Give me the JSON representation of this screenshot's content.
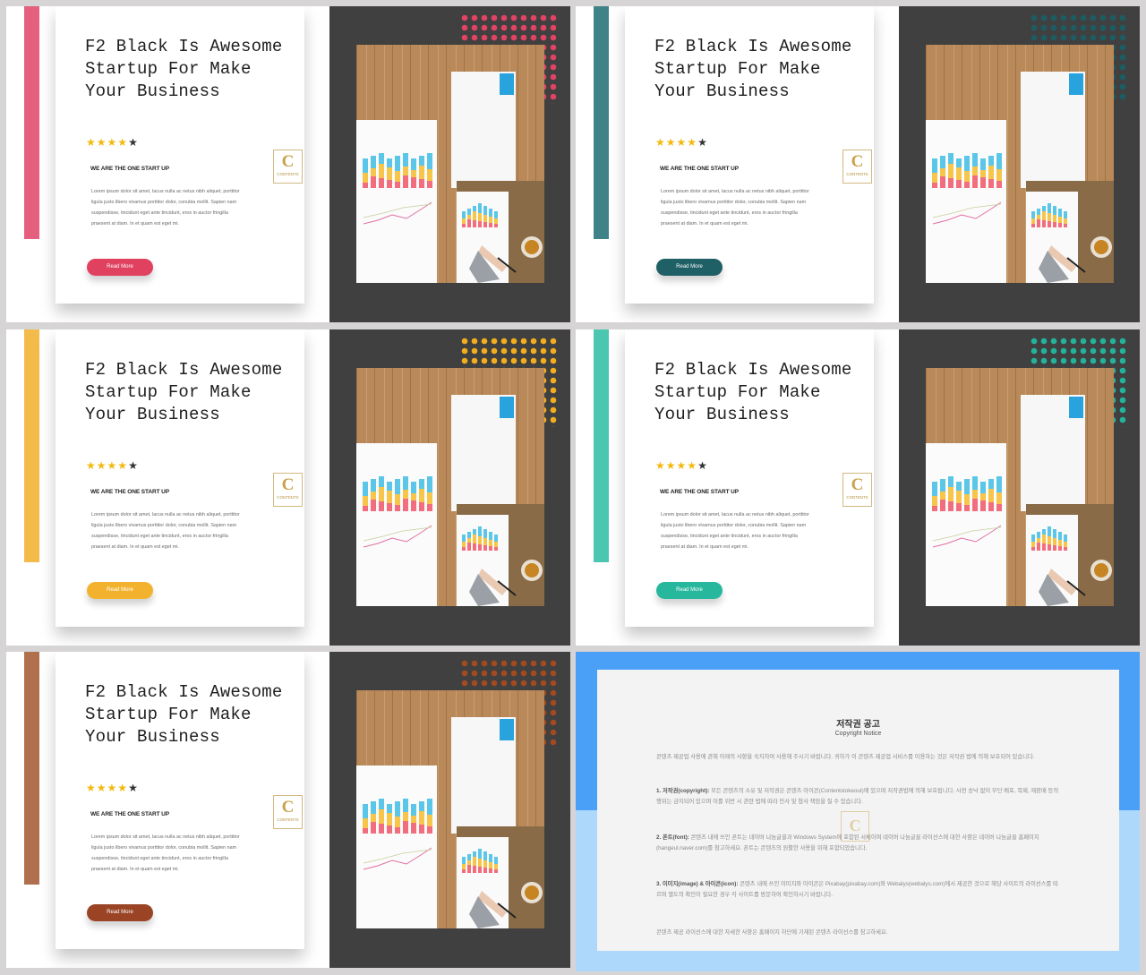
{
  "slides": [
    {
      "title": "F2 Black Is Awesome Startup For Make Your Business",
      "rating": 4,
      "rating_max": 5,
      "subtitle": "WE ARE THE ONE START UP",
      "body": "Lorem ipsum dolor sit amet, lacus nulla ac netus nibh aliquet, porttitor ligula justo libero vivamus porttitor dolor, conubia mollit. Sapien nam suspendisse, tincidunt eget ante tincidunt, eros in auctor fringilla praesent at diam. In et quam est eget mi.",
      "button": "Read More",
      "logo_letter": "C",
      "logo_text": "CONTENTS",
      "accent": "#e55f7e",
      "button_color": "#e0415f",
      "dots_color": "#e24363"
    },
    {
      "title": "F2 Black Is Awesome Startup For Make Your Business",
      "rating": 4,
      "rating_max": 5,
      "subtitle": "WE ARE THE ONE START UP",
      "body": "Lorem ipsum dolor sit amet, lacus nulla ac netus nibh aliquet, porttitor ligula justo libero vivamus porttitor dolor, conubia mollit. Sapien nam suspendisse, tincidunt eget ante tincidunt, eros in auctor fringilla praesent at diam. In et quam est eget mi.",
      "button": "Read More",
      "logo_letter": "C",
      "logo_text": "CONTENTS",
      "accent": "#3f8388",
      "button_color": "#1f5f66",
      "dots_color": "#1c5c63"
    },
    {
      "title": "F2 Black Is Awesome Startup For Make Your Business",
      "rating": 4,
      "rating_max": 5,
      "subtitle": "WE ARE THE ONE START UP",
      "body": "Lorem ipsum dolor sit amet, lacus nulla ac netus nibh aliquet, porttitor ligula justo libero vivamus porttitor dolor, conubia mollit. Sapien nam suspendisse, tincidunt eget ante tincidunt, eros in auctor fringilla praesent at diam. In et quam est eget mi.",
      "button": "Read More",
      "logo_letter": "C",
      "logo_text": "CONTENTS",
      "accent": "#f2bb4a",
      "button_color": "#f2b22e",
      "dots_color": "#f2ae1f"
    },
    {
      "title": "F2 Black Is Awesome Startup For Make Your Business",
      "rating": 4,
      "rating_max": 5,
      "subtitle": "WE ARE THE ONE START UP",
      "body": "Lorem ipsum dolor sit amet, lacus nulla ac netus nibh aliquet, porttitor ligula justo libero vivamus porttitor dolor, conubia mollit. Sapien nam suspendisse, tincidunt eget ante tincidunt, eros in auctor fringilla praesent at diam. In et quam est eget mi.",
      "button": "Read More",
      "logo_letter": "C",
      "logo_text": "CONTENTS",
      "accent": "#4bc7b1",
      "button_color": "#27b79d",
      "dots_color": "#23b39b"
    },
    {
      "title": "F2 Black Is Awesome Startup For Make Your Business",
      "rating": 4,
      "rating_max": 5,
      "subtitle": "WE ARE THE ONE START UP",
      "body": "Lorem ipsum dolor sit amet, lacus nulla ac netus nibh aliquet, porttitor ligula justo libero vivamus porttitor dolor, conubia mollit. Sapien nam suspendisse, tincidunt eget ante tincidunt, eros in auctor fringilla praesent at diam. In et quam est eget mi.",
      "button": "Read More",
      "logo_letter": "C",
      "logo_text": "CONTENTS",
      "accent": "#b0704d",
      "button_color": "#9a4425",
      "dots_color": "#a24a20"
    }
  ],
  "notice": {
    "title": "저작권 공고",
    "subtitle": "Copyright Notice",
    "intro": "콘텐츠 제공업 사용에 관해 아래의 사항을 숙지하여 사용해 주시기 바랍니다. 귀하가 이 콘텐츠 제공업 서비스를 이용하는 것은 저작권 법에 의해 보호되어 있습니다.",
    "p1_head": "1. 저작권(copyright):",
    "p1": "모든 콘텐츠의 소유 및 저작권은 콘텐츠 아이콘(Contentstokeout)에 있으며 저작권법에 의해 보호됩니다. 사전 승낙 없이 무단 배포, 복제, 재판매 등의 행위는 금지되어 있으며 이를 위반 시 관련 법에 따라 민사 및 형사 책임을 질 수 있습니다.",
    "p2_head": "2. 폰트(font):",
    "p2": "콘텐츠 내에 쓰인 폰트는 네이버 나눔글꼴과 Windows System에 포함된 서체이며 네이버 나눔글꼴 라이선스에 대한 사항은 네이버 나눔글꼴 홈페이지(hangeul.naver.com)를 참고하세요. 폰트는 콘텐츠의 원활한 사용을 위해 포함되었습니다.",
    "p3_head": "3. 이미지(image) & 아이콘(icon):",
    "p3": "콘텐츠 내에 쓰인 이미지와 아이콘은 Pixabay(pixabay.com)와 Webalys(webalys.com)에서 제공한 것으로 해당 사이트의 라이선스를 따르며 별도의 확인이 필요한 경우 각 사이트를 방문하여 확인하시기 바랍니다.",
    "outro": "콘텐츠 제공 라이선스에 대한 자세한 사항은 홈페이지 하단에 기재된 콘텐츠 라이선스를 참고하세요."
  }
}
